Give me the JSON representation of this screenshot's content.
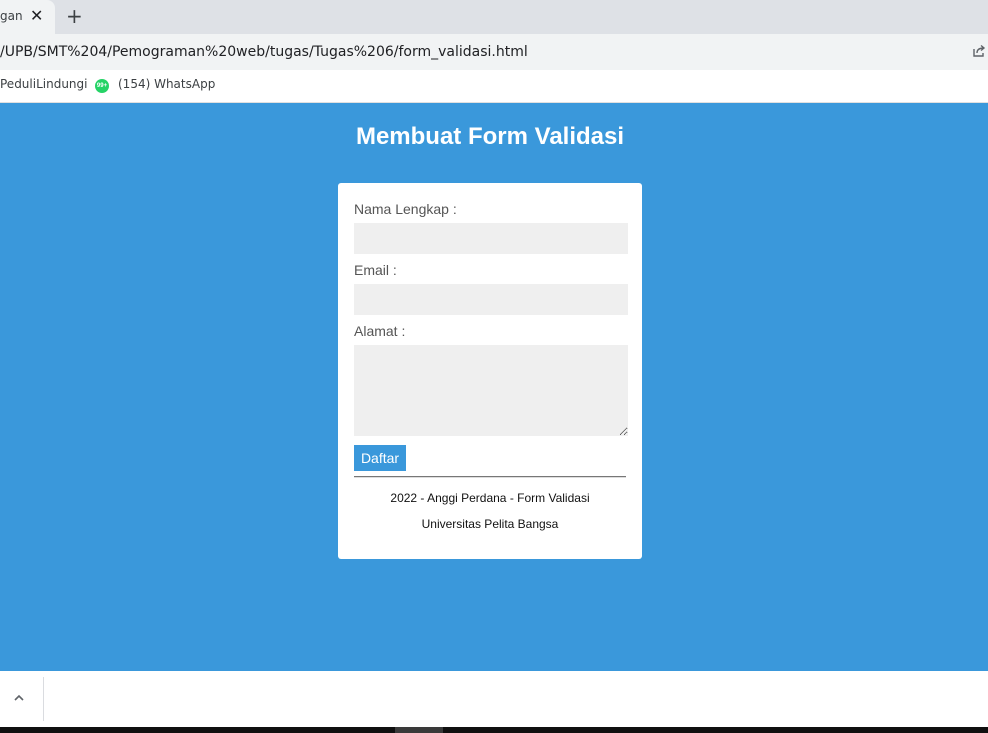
{
  "browser": {
    "tab_title": "gan",
    "url": "/UPB/SMT%204/Pemograman%20web/tugas/Tugas%206/form_validasi.html",
    "bookmarks": [
      {
        "label": "PeduliLindungi"
      },
      {
        "label": "(154) WhatsApp",
        "badge": "99+"
      }
    ]
  },
  "page": {
    "title": "Membuat Form Validasi",
    "background_color": "#3a98db"
  },
  "form": {
    "name_label": "Nama Lengkap :",
    "name_value": "",
    "email_label": "Email :",
    "email_value": "",
    "address_label": "Alamat :",
    "address_value": "",
    "submit_label": "Daftar"
  },
  "footer": {
    "line1": "2022 - Anggi Perdana - Form Validasi",
    "line2": "Universitas Pelita Bangsa"
  }
}
